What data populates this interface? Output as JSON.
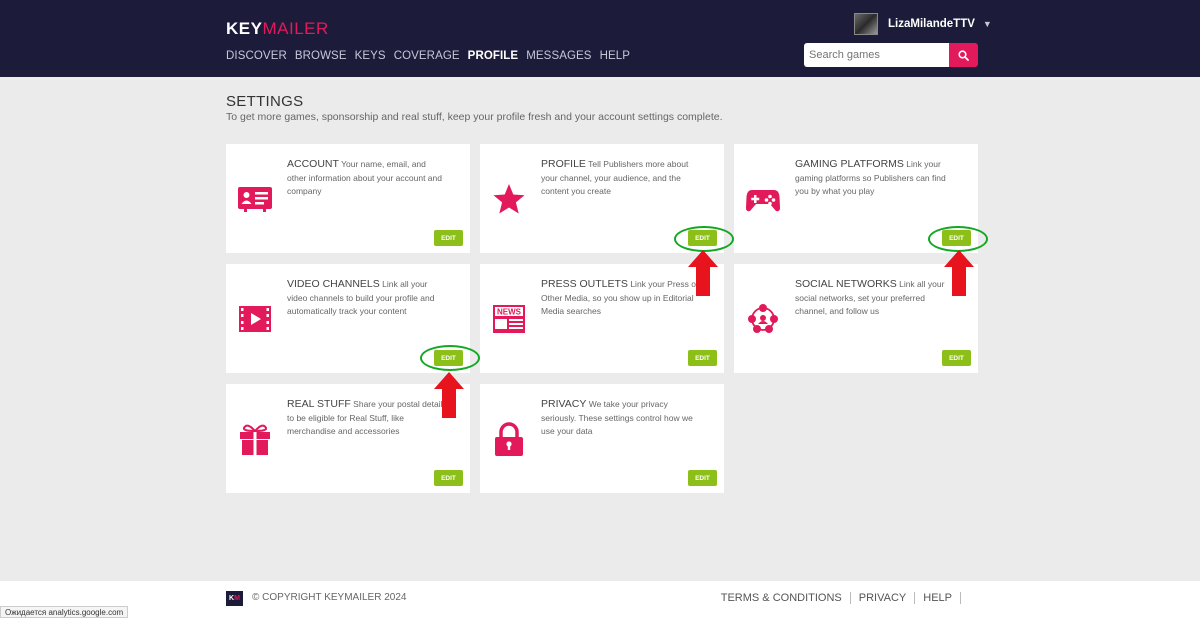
{
  "brand": {
    "logo_left": "KEY",
    "logo_right": "MAILER",
    "accent": "#e2195a",
    "edit_color": "#8cbf17",
    "header_bg": "#1c1c3a"
  },
  "nav": [
    {
      "label": "DISCOVER",
      "active": false
    },
    {
      "label": "BROWSE",
      "active": false
    },
    {
      "label": "KEYS",
      "active": false
    },
    {
      "label": "COVERAGE",
      "active": false
    },
    {
      "label": "PROFILE",
      "active": true
    },
    {
      "label": "MESSAGES",
      "active": false
    },
    {
      "label": "HELP",
      "active": false
    }
  ],
  "user": {
    "name": "LizaMilandeTTV"
  },
  "search": {
    "placeholder": "Search games",
    "icon": "search-icon"
  },
  "page": {
    "title": "SETTINGS",
    "subtitle": "To get more games, sponsorship and real stuff, keep your profile fresh and your account settings complete."
  },
  "cards": [
    {
      "title": "ACCOUNT",
      "desc": "Your name, email, and other information about your account and company",
      "icon": "id-card-icon",
      "edit": "EDIT"
    },
    {
      "title": "PROFILE",
      "desc": "Tell Publishers more about your channel, your audience, and the content you create",
      "icon": "star-icon",
      "edit": "EDIT"
    },
    {
      "title": "GAMING PLATFORMS",
      "desc": "Link your gaming platforms so Publishers can find you by what you play",
      "icon": "gamepad-icon",
      "edit": "EDIT"
    },
    {
      "title": "VIDEO CHANNELS",
      "desc": "Link all your video channels to build your profile and automatically track your content",
      "icon": "video-icon",
      "edit": "EDIT"
    },
    {
      "title": "PRESS OUTLETS",
      "desc": "Link your Press or Other Media, so you show up in Editorial Media searches",
      "icon": "newspaper-icon",
      "edit": "EDIT"
    },
    {
      "title": "SOCIAL NETWORKS",
      "desc": "Link all your social networks, set your preferred channel, and follow us",
      "icon": "social-network-icon",
      "edit": "EDIT"
    },
    {
      "title": "REAL STUFF",
      "desc": "Share your postal details to be eligible for Real Stuff, like merchandise and accessories",
      "icon": "gift-icon",
      "edit": "EDIT"
    },
    {
      "title": "PRIVACY",
      "desc": "We take your privacy seriously. These settings control how we use your data",
      "icon": "lock-icon",
      "edit": "EDIT"
    }
  ],
  "footer": {
    "logo_left": "K",
    "logo_right": "M",
    "copyright": "© COPYRIGHT KEYMAILER 2024",
    "links": [
      "TERMS & CONDITIONS",
      "PRIVACY",
      "HELP"
    ]
  },
  "status_bar": "Ожидается analytics.google.com"
}
